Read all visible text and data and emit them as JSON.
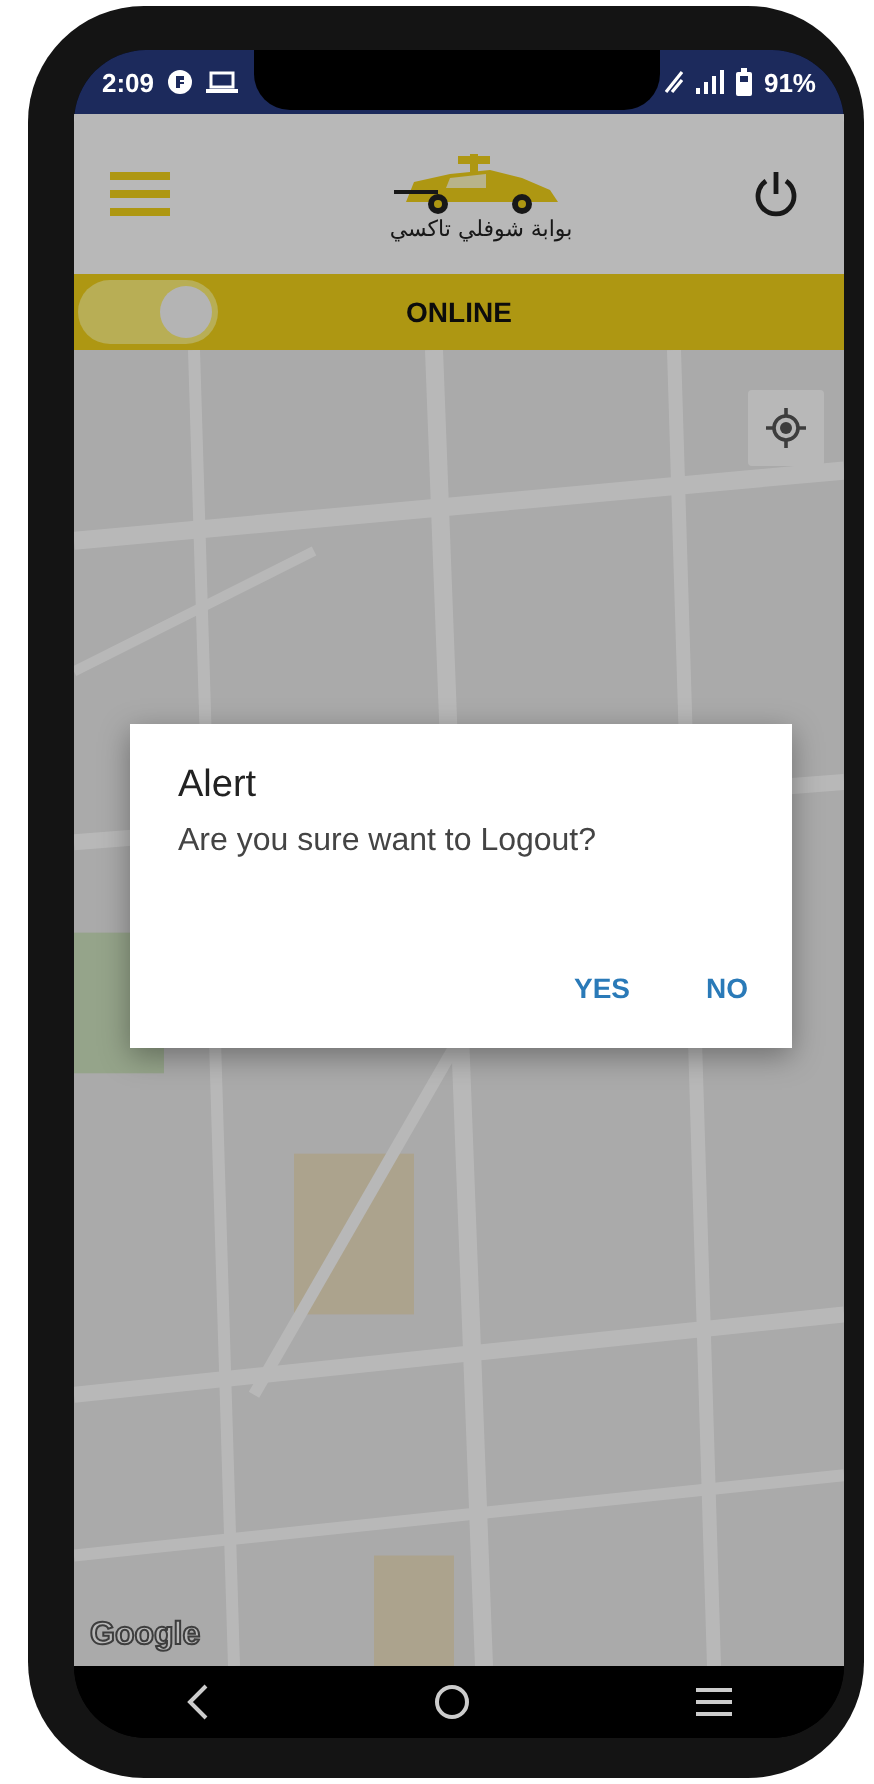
{
  "status_bar": {
    "time": "2:09",
    "battery": "91%"
  },
  "app_bar": {
    "logo_text": "بوابة شوفلي تاكسي"
  },
  "online_bar": {
    "switch_on": true,
    "label": "ONLINE"
  },
  "map": {
    "attribution": "Google"
  },
  "dialog": {
    "title": "Alert",
    "message": "Are you sure want to Logout?",
    "buttons": [
      {
        "label": "YES"
      },
      {
        "label": "NO"
      }
    ]
  }
}
